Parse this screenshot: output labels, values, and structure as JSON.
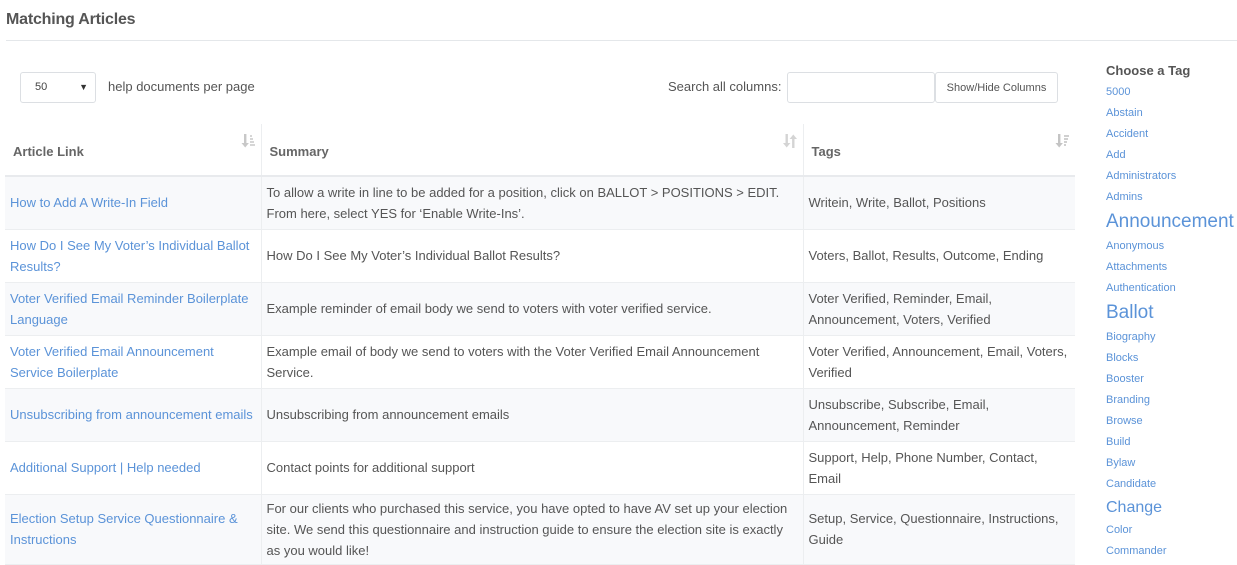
{
  "page": {
    "title": "Matching Articles"
  },
  "controls": {
    "page_length_value": "50",
    "page_length_label": "help documents per page",
    "search_label": "Search all columns:",
    "search_value": "",
    "colvis_label": "Show/Hide Columns"
  },
  "table": {
    "columns": [
      {
        "label": "Article Link",
        "sort_icon": "sort-amount-asc-icon"
      },
      {
        "label": "Summary",
        "sort_icon": "sort-unsorted-icon"
      },
      {
        "label": "Tags",
        "sort_icon": "sort-alpha-desc-icon"
      }
    ],
    "rows": [
      {
        "title": "How to Add A Write-In Field",
        "summary": "To allow a write in line to be added for a position, click on BALLOT > POSITIONS > EDIT. From here, select YES for ‘Enable Write-Ins’.",
        "tags": "Writein, Write, Ballot, Positions"
      },
      {
        "title": "How Do I See My Voter’s Individual Ballot Results?",
        "summary": "How Do I See My Voter’s Individual Ballot Results?",
        "tags": "Voters, Ballot, Results, Outcome, Ending"
      },
      {
        "title": "Voter Verified Email Reminder Boilerplate Language",
        "summary": "Example reminder of email body we send to voters with voter verified service.",
        "tags": "Voter Verified, Reminder, Email, Announcement, Voters, Verified"
      },
      {
        "title": "Voter Verified Email Announcement Service Boilerplate",
        "summary": "Example email of body we send to voters with the Voter Verified Email Announcement Service.",
        "tags": "Voter Verified, Announcement, Email, Voters, Verified"
      },
      {
        "title": "Unsubscribing from announcement emails",
        "summary": "Unsubscribing from announcement emails",
        "tags": "Unsubscribe, Subscribe, Email, Announcement, Reminder"
      },
      {
        "title": "Additional Support | Help needed",
        "summary": "Contact points for additional support",
        "tags": "Support, Help, Phone Number, Contact, Email"
      },
      {
        "title": "Election Setup Service Questionnaire & Instructions",
        "summary": "For our clients who purchased this service, you have opted to have AV set up your election site. We send this questionnaire and instruction guide to ensure the election site is exactly as you would like!",
        "tags": "Setup, Service, Questionnaire, Instructions, Guide"
      }
    ]
  },
  "tag_cloud": {
    "heading": "Choose a Tag",
    "tags": [
      {
        "label": "5000",
        "weight": "small"
      },
      {
        "label": "Abstain",
        "weight": "small"
      },
      {
        "label": "Accident",
        "weight": "small"
      },
      {
        "label": "Add",
        "weight": "small"
      },
      {
        "label": "Administrators",
        "weight": "small"
      },
      {
        "label": "Admins",
        "weight": "small"
      },
      {
        "label": "Announcement",
        "weight": "big"
      },
      {
        "label": "Anonymous",
        "weight": "small"
      },
      {
        "label": "Attachments",
        "weight": "small"
      },
      {
        "label": "Authentication",
        "weight": "small"
      },
      {
        "label": "Ballot",
        "weight": "big"
      },
      {
        "label": "Biography",
        "weight": "small"
      },
      {
        "label": "Blocks",
        "weight": "small"
      },
      {
        "label": "Booster",
        "weight": "small"
      },
      {
        "label": "Branding",
        "weight": "small"
      },
      {
        "label": "Browse",
        "weight": "small"
      },
      {
        "label": "Build",
        "weight": "small"
      },
      {
        "label": "Bylaw",
        "weight": "small"
      },
      {
        "label": "Candidate",
        "weight": "small"
      },
      {
        "label": "Change",
        "weight": "medium"
      },
      {
        "label": "Color",
        "weight": "small"
      },
      {
        "label": "Commander",
        "weight": "small"
      }
    ]
  },
  "colors": {
    "link": "#5b93d8",
    "text": "#555555",
    "stripe": "#f8f9fb",
    "border": "#eceef0"
  }
}
